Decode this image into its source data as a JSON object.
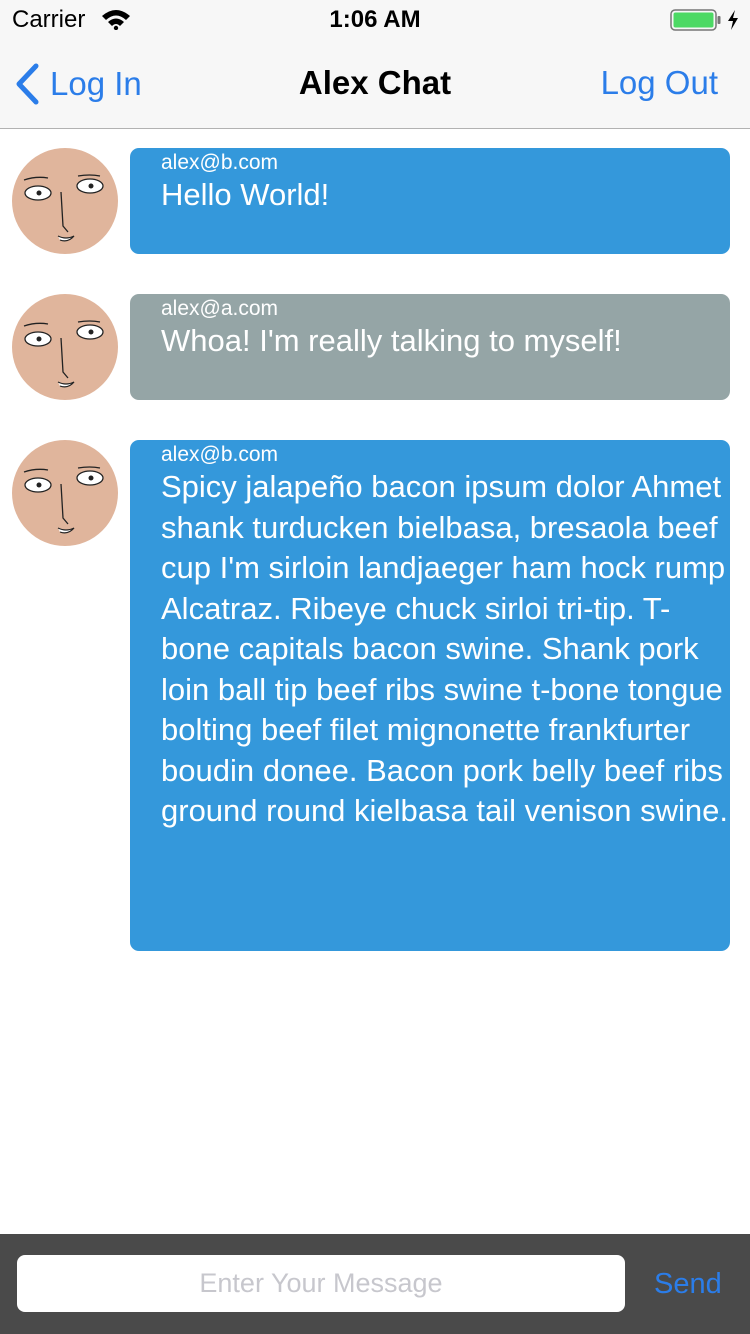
{
  "status": {
    "carrier": "Carrier",
    "time": "1:06 AM",
    "battery_color": "#4cd964"
  },
  "nav": {
    "back_label": "Log In",
    "title": "Alex Chat",
    "logout_label": "Log Out",
    "accent": "#2b7de9"
  },
  "messages": [
    {
      "sender": "alex@b.com",
      "text": "Hello World!",
      "bubble_color": "#3498db"
    },
    {
      "sender": "alex@a.com",
      "text": "Whoa! I'm really talking to myself!",
      "bubble_color": "#95a5a6"
    },
    {
      "sender": "alex@b.com",
      "text": "Spicy jalapeño bacon ipsum dolor Ahmet shank turducken bielbasa, bresaola beef cup I'm sirloin landjaeger ham hock rump Alcatraz. Ribeye chuck sirloi tri-tip. T-bone capitals bacon swine. Shank pork loin ball tip beef ribs swine t-bone tongue bolting beef filet mignonette frankfurter boudin donee. Bacon pork belly beef ribs ground round kielbasa tail venison swine.",
      "bubble_color": "#3498db"
    }
  ],
  "composer": {
    "placeholder": "Enter Your Message",
    "value": "",
    "send_label": "Send"
  }
}
